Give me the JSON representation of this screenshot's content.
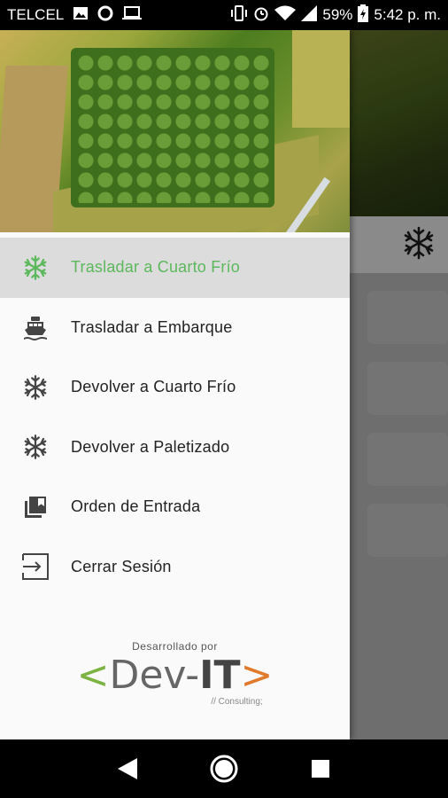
{
  "status_bar": {
    "carrier": "TELCEL",
    "battery": "59%",
    "time": "5:42 p. m."
  },
  "drawer": {
    "menu": [
      {
        "label": "Trasladar a Cuarto Frío",
        "icon": "snowflake-icon",
        "active": true
      },
      {
        "label": "Trasladar a Embarque",
        "icon": "ship-icon",
        "active": false
      },
      {
        "label": "Devolver a Cuarto Frío",
        "icon": "snowflake-icon",
        "active": false
      },
      {
        "label": "Devolver a Paletizado",
        "icon": "snowflake-icon",
        "active": false
      },
      {
        "label": "Orden de Entrada",
        "icon": "library-icon",
        "active": false
      },
      {
        "label": "Cerrar Sesión",
        "icon": "logout-icon",
        "active": false
      }
    ],
    "footer": {
      "developed_by": "Desarrollado por",
      "logo_open": "<",
      "logo_dev": "Dev-",
      "logo_it": "IT",
      "logo_close": ">",
      "logo_sub": "// Consulting;"
    }
  },
  "colors": {
    "active_accent": "#5cb85c",
    "logo_green": "#7cb342",
    "logo_orange": "#e27a2c"
  }
}
